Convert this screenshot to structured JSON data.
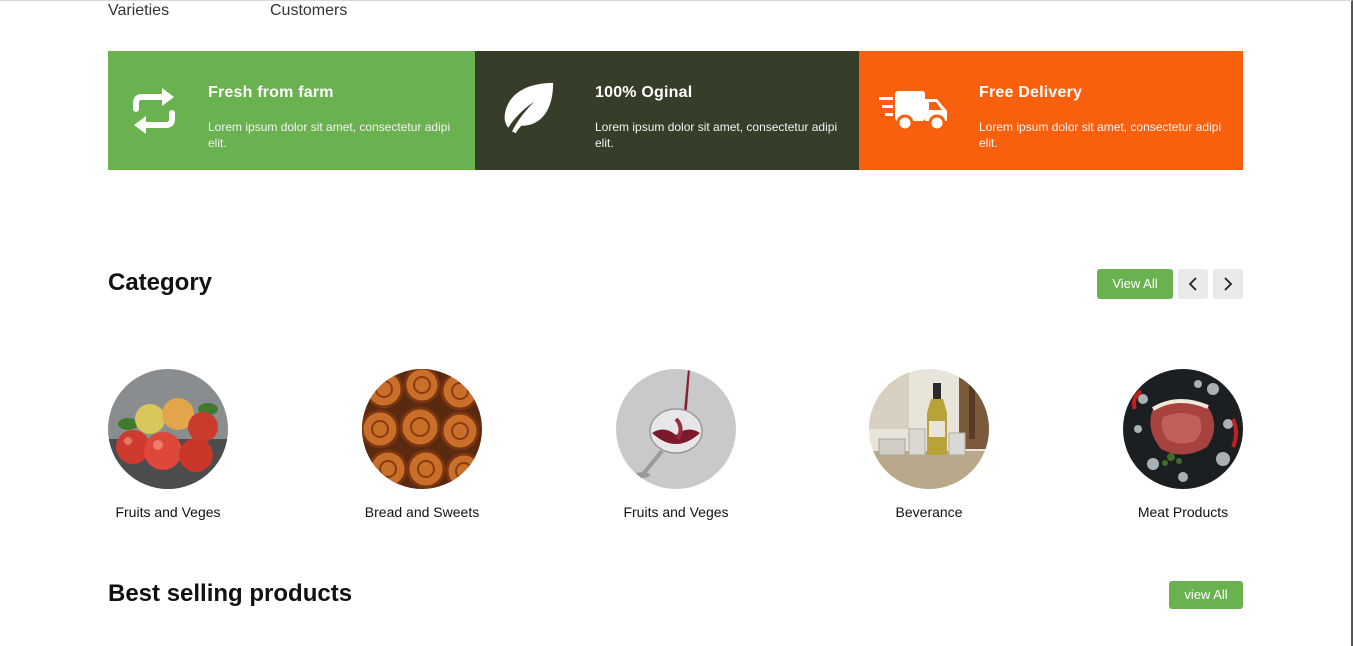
{
  "stats": {
    "label1": "Varieties",
    "label2": "Customers"
  },
  "features": [
    {
      "title": "Fresh from farm",
      "description": "Lorem ipsum dolor sit amet, consectetur adipi elit.",
      "icon": "refresh-icon",
      "color": "#6ab150"
    },
    {
      "title": "100% Oginal",
      "description": "Lorem ipsum dolor sit amet, consectetur adipi elit.",
      "icon": "leaf-icon",
      "color": "#363d29"
    },
    {
      "title": "Free Delivery",
      "description": "Lorem ipsum dolor sit amet, consectetur adipi elit.",
      "icon": "delivery-truck-icon",
      "color": "#f9600d"
    }
  ],
  "category": {
    "title": "Category",
    "view_all_label": "View All",
    "items": [
      {
        "label": "Fruits and Veges",
        "image": "apples-image"
      },
      {
        "label": "Bread and Sweets",
        "image": "cinnamon-rolls-image"
      },
      {
        "label": "Fruits and Veges",
        "image": "wine-glass-image"
      },
      {
        "label": "Beverance",
        "image": "oil-bottles-image"
      },
      {
        "label": "Meat Products",
        "image": "steak-image"
      }
    ]
  },
  "best_selling": {
    "title": "Best selling products",
    "view_all_label": "view All"
  },
  "colors": {
    "brand_green": "#6ab150",
    "dark_olive": "#363d29",
    "orange": "#f9600d"
  }
}
